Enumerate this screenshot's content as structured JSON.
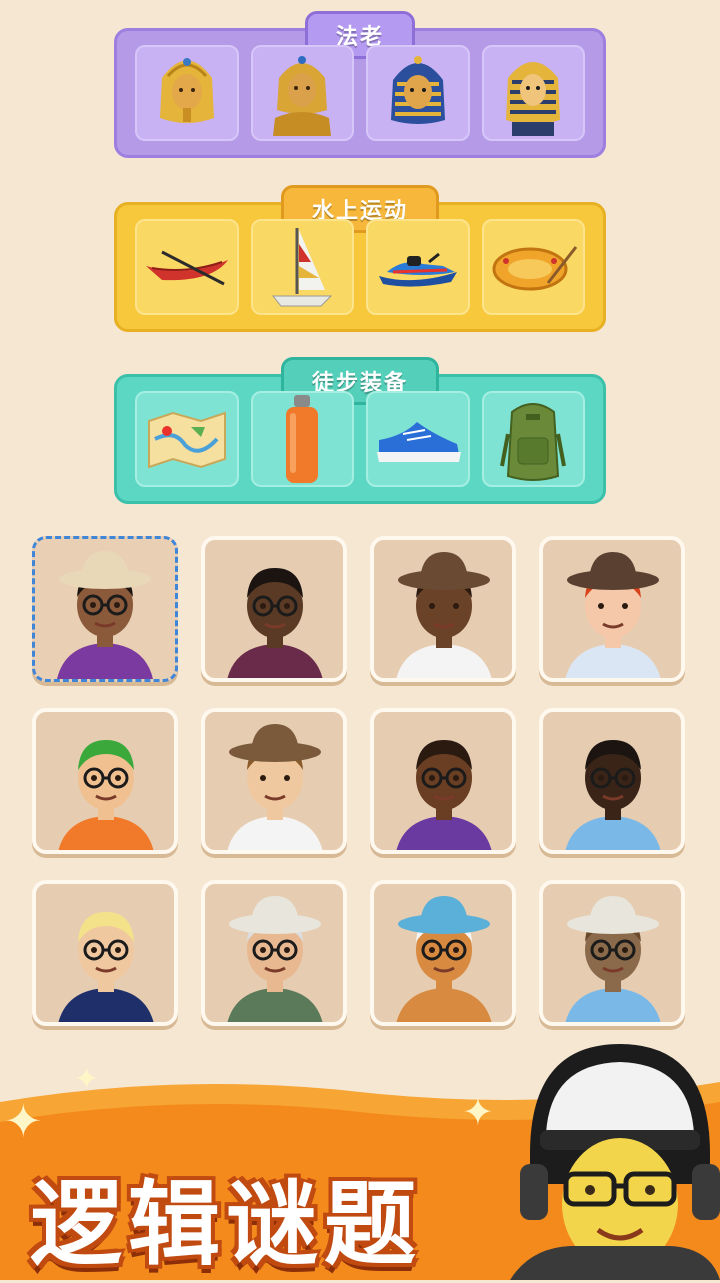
{
  "categories": [
    {
      "title": "法老",
      "items": [
        "pharaoh-gold-icon",
        "pharaoh-bust-icon",
        "pharaoh-striped-icon",
        "pharaoh-mask-icon"
      ]
    },
    {
      "title": "水上运动",
      "items": [
        "canoe-icon",
        "sailboat-icon",
        "jetski-icon",
        "raft-icon"
      ]
    },
    {
      "title": "徒步装备",
      "items": [
        "map-icon",
        "water-bottle-icon",
        "sneaker-icon",
        "backpack-icon"
      ]
    }
  ],
  "characters": [
    "wizard-hat-woman-avatar",
    "bearded-man-avatar",
    "fedora-man-avatar",
    "red-braids-girl-avatar",
    "green-hair-basketball-avatar",
    "hat-woman-avatar",
    "braided-woman-avatar",
    "sunglasses-man-avatar",
    "blonde-player-avatar",
    "hat-old-man-avatar",
    "hat-cat-avatar",
    "hat-seal-avatar"
  ],
  "banner": {
    "title": "逻辑谜题"
  },
  "colors": {
    "purple": "#b59ae8",
    "yellow": "#f7c83c",
    "teal": "#5cd7c3",
    "background": "#f6e7d3",
    "banner": "#f48a1c"
  }
}
